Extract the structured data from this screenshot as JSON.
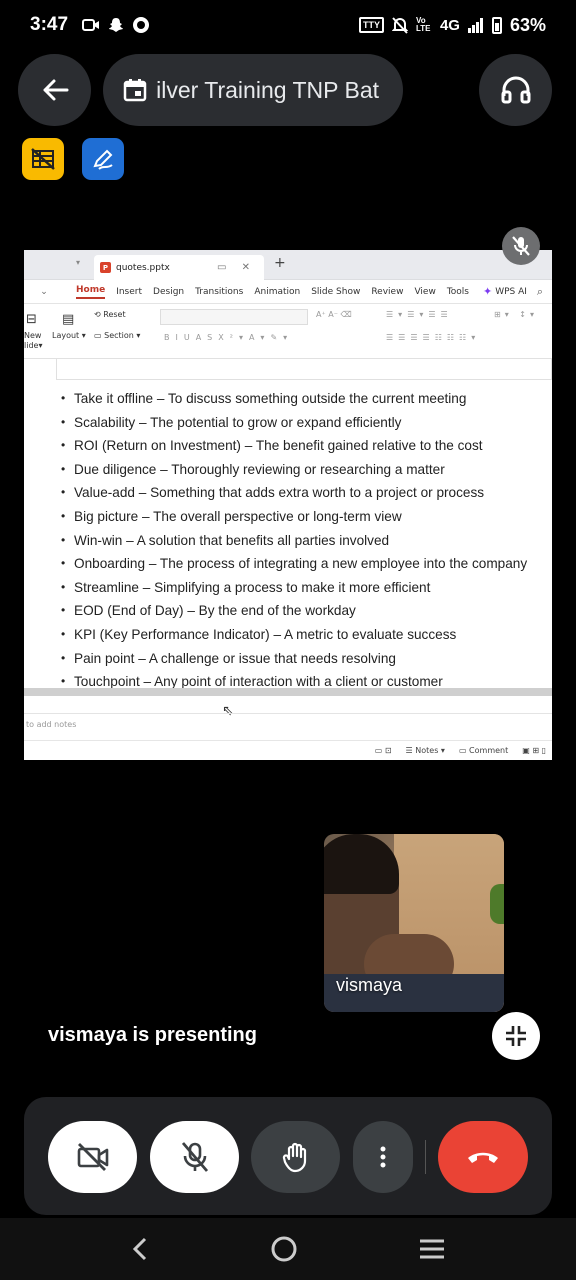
{
  "status_bar": {
    "time": "3:47",
    "icons_left": [
      "video-call-icon",
      "snapchat-icon",
      "messenger-icon"
    ],
    "tty": "TTY",
    "volte": "Vo LTE",
    "network": "4G",
    "battery_pct": "63%"
  },
  "header": {
    "back_icon": "arrow-left-icon",
    "meeting_title": "ilver Training TNP Bat",
    "calendar_icon": "calendar-icon",
    "audio_icon": "headphones-icon"
  },
  "chips": {
    "hide_tiles_icon": "grid-off-icon",
    "annotate_icon": "pen-edit-icon"
  },
  "shared_screen": {
    "tab_title": "quotes.pptx",
    "tab_icon_letter": "P",
    "menu": [
      "Home",
      "Insert",
      "Design",
      "Transitions",
      "Animation",
      "Slide Show",
      "Review",
      "View",
      "Tools"
    ],
    "active_menu": "Home",
    "wps_ai": "WPS AI",
    "ribbon": {
      "new_slide": "New",
      "new_slide2": "lide▾",
      "layout": "Layout ▾",
      "reset": "Reset",
      "section": "Section ▾"
    },
    "bullets": [
      "Take it offline – To discuss something outside the current meeting",
      "Scalability – The potential to grow or expand efficiently",
      "ROI (Return on Investment) – The benefit gained relative to the cost",
      "Due diligence – Thoroughly reviewing or researching a matter",
      "Value-add – Something that adds extra worth to a project or process",
      "Big picture – The overall perspective or long-term view",
      "Win-win – A solution that benefits all parties involved",
      "Onboarding – The process of integrating a new employee into the company",
      "Streamline – Simplifying a process to make it more efficient",
      "EOD (End of Day) – By the end of the workday",
      "KPI (Key Performance Indicator) – A metric to evaluate success",
      "Pain point – A challenge or issue that needs resolving",
      "Touchpoint – Any point of interaction with a client or customer"
    ],
    "notes_placeholder": "to add notes",
    "status": {
      "notes": "Notes ▾",
      "comment": "Comment"
    }
  },
  "self_view": {
    "name": "vismaya"
  },
  "presenting_text": "vismaya is presenting",
  "controls": {
    "camera_icon": "camera-off-icon",
    "mic_icon": "mic-off-icon",
    "hand_icon": "raise-hand-icon",
    "more_icon": "more-vert-icon",
    "end_icon": "end-call-icon",
    "end_color": "#ea4335"
  },
  "nav": {
    "back": "nav-back-icon",
    "home": "nav-home-icon",
    "recents": "nav-recents-icon"
  }
}
